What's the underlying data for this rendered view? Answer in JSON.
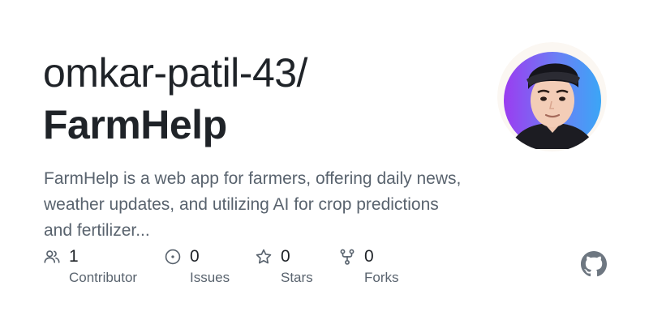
{
  "repo": {
    "owner": "omkar-patil-43/",
    "name": "FarmHelp",
    "description": "FarmHelp is a web app for farmers, offering daily news, weather updates, and utilizing AI for crop predictions and fertilizer..."
  },
  "stats": [
    {
      "icon": "people-icon",
      "count": "1",
      "label": "Contributor"
    },
    {
      "icon": "issue-opened-icon",
      "count": "0",
      "label": "Issues"
    },
    {
      "icon": "star-icon",
      "count": "0",
      "label": "Stars"
    },
    {
      "icon": "repo-forked-icon",
      "count": "0",
      "label": "Forks"
    }
  ],
  "colors": {
    "title": "#1f2328",
    "muted": "#59636e",
    "icon": "#59636e",
    "github_mark": "#6e7781"
  }
}
